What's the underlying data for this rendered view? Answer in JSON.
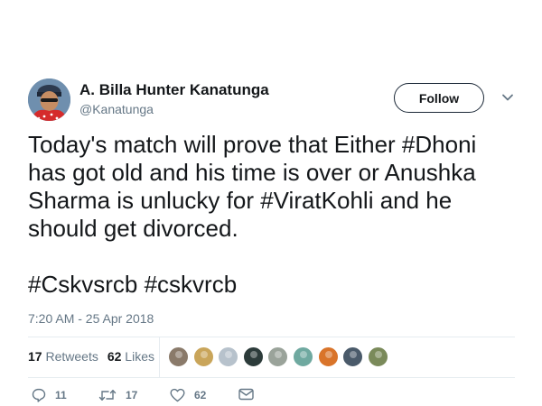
{
  "author": {
    "name": "A. Billa Hunter Kanatunga",
    "handle": "@Kanatunga"
  },
  "follow_button": {
    "label": "Follow"
  },
  "tweet": {
    "lines_paragraph_1": [
      "Today's match will prove that Either #Dhoni",
      "has got old and his time is over or Anushka",
      "Sharma is unlucky for #ViratKohli and he",
      "should get divorced."
    ],
    "line_paragraph_2": "#Cskvsrcb #cskvrcb",
    "timestamp": "7:20 AM - 25 Apr 2018"
  },
  "stats": {
    "retweets_count": "17",
    "retweets_label": "Retweets",
    "likes_count": "62",
    "likes_label": "Likes"
  },
  "likers": {
    "colors": [
      "#8a7a6a",
      "#c9a55a",
      "#b7c2cc",
      "#2c3b3a",
      "#9aa39a",
      "#6fa9a0",
      "#d9742a",
      "#4a5a6a",
      "#7a8a5a"
    ]
  },
  "actions": {
    "reply_count": "11",
    "retweet_count": "17",
    "like_count": "62"
  },
  "colors": {
    "text_primary": "#14171a",
    "text_secondary": "#657786",
    "divider": "#e6ecf0"
  },
  "icons": [
    "chevron-down-icon",
    "reply-icon",
    "retweet-icon",
    "like-icon",
    "message-icon"
  ]
}
